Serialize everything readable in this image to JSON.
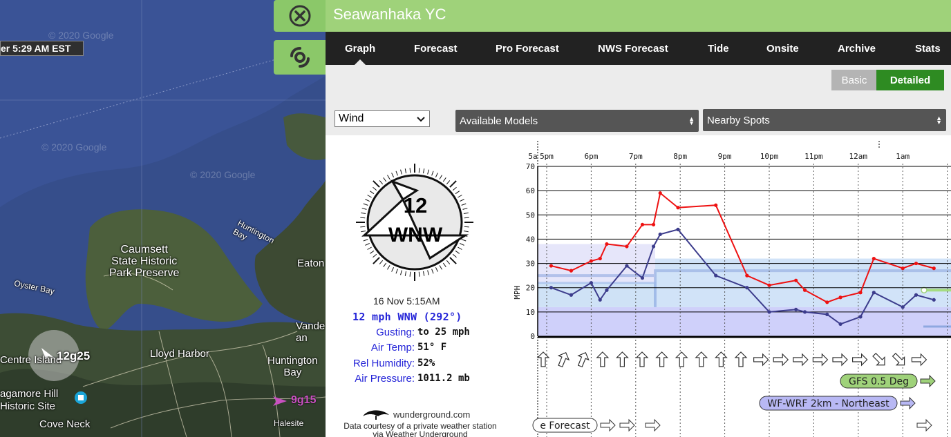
{
  "map": {
    "time_label": "er 5:29 AM EST",
    "watermark": "© 2020 Google",
    "labels": {
      "caumsett": "Caumsett\nState Historic\nPark Preserve",
      "huntington_bay": "Huntington\nBay",
      "eatons": "Eaton",
      "oyster_bay": "Oyster Bay",
      "lloyd_harbor": "Lloyd Harbor",
      "huntington_bay2": "Huntington\nBay",
      "vande": "Vande\nan",
      "centre_island": "Centre Island",
      "sagamore": "agamore Hill\nHistoric Site",
      "cove_neck": "Cove Neck",
      "station_obs": "12g25",
      "station2_obs": "9g15",
      "halesite": "Halesite"
    },
    "buttons": {
      "close_icon": "close-circle-icon",
      "storm_icon": "hurricane-icon"
    }
  },
  "panel": {
    "title": "Seawanhaka YC",
    "tabs": [
      "Graph",
      "Forecast",
      "Pro Forecast",
      "NWS Forecast",
      "Tide",
      "Onsite",
      "Archive",
      "Stats"
    ],
    "active_tab": "Graph",
    "view_toggle": {
      "basic": "Basic",
      "detailed": "Detailed",
      "active": "Detailed"
    },
    "selects": {
      "variable": "Wind",
      "models": "Available Models",
      "spots": "Nearby Spots"
    }
  },
  "obs": {
    "speed": "12",
    "direction": "WNW",
    "date": "16 Nov 5:15AM",
    "wind_line": "12 mph WNW (292°)",
    "rows": [
      {
        "label": "Gusting:",
        "value": "to 25 mph"
      },
      {
        "label": "Air Temp:",
        "value": "51° F"
      },
      {
        "label": "Rel Humidity:",
        "value": "52%"
      },
      {
        "label": "Air Pressure:",
        "value": "1011.2 mb"
      }
    ],
    "source_logo_text": "wunderground.com",
    "credit": "Data courtesy of a private weather station via Weather Underground"
  },
  "chart_data": {
    "type": "line",
    "x_ticks": [
      "5a",
      "5pm",
      "6pm",
      "7pm",
      "8pm",
      "9pm",
      "10pm",
      "11pm",
      "12am",
      "1am"
    ],
    "ylabel": "MPH",
    "ylim": [
      0,
      70
    ],
    "y_ticks": [
      0,
      10,
      20,
      30,
      40,
      50,
      60,
      70
    ],
    "x_hours": "hours after 4pm",
    "series": [
      {
        "role": "gust",
        "color": "#ee1111",
        "x": [
          0.1,
          0.55,
          1.0,
          1.2,
          1.35,
          1.8,
          2.15,
          2.4,
          2.55,
          2.95,
          3.8,
          4.5,
          5.0,
          5.6,
          5.8,
          6.3,
          6.6,
          7.05,
          7.35,
          8.0,
          8.3,
          8.7
        ],
        "y": [
          29,
          27,
          31,
          32,
          38,
          37,
          46,
          46,
          59,
          53,
          54,
          25,
          21,
          23,
          19,
          14,
          16,
          18,
          32,
          28,
          30,
          28
        ]
      },
      {
        "role": "average",
        "color": "#3c3c8c",
        "x": [
          0.1,
          0.55,
          1.0,
          1.2,
          1.35,
          1.8,
          2.15,
          2.4,
          2.55,
          2.95,
          3.8,
          4.5,
          5.0,
          5.6,
          5.8,
          6.3,
          6.6,
          7.05,
          7.35,
          8.0,
          8.3,
          8.7
        ],
        "y": [
          20,
          17,
          22,
          15,
          19,
          29,
          24,
          37,
          42,
          44,
          25,
          20,
          10,
          11,
          10,
          9,
          5,
          8,
          18,
          12,
          17,
          15
        ]
      }
    ],
    "direction_arrows": [
      "N",
      "NNE",
      "NNE",
      "N",
      "N",
      "N",
      "N",
      "N",
      "N",
      "N",
      "N",
      "E",
      "E",
      "E",
      "E",
      "E",
      "E",
      "SE",
      "SE",
      "E"
    ],
    "models": [
      {
        "name": "GFS 0.5 Deg",
        "color": "#9fd27a"
      },
      {
        "name": "WF-WRF 2km - Northeast",
        "color": "#b8b8f4"
      },
      {
        "name": "e Forecast",
        "color": "#ffffff"
      }
    ]
  }
}
